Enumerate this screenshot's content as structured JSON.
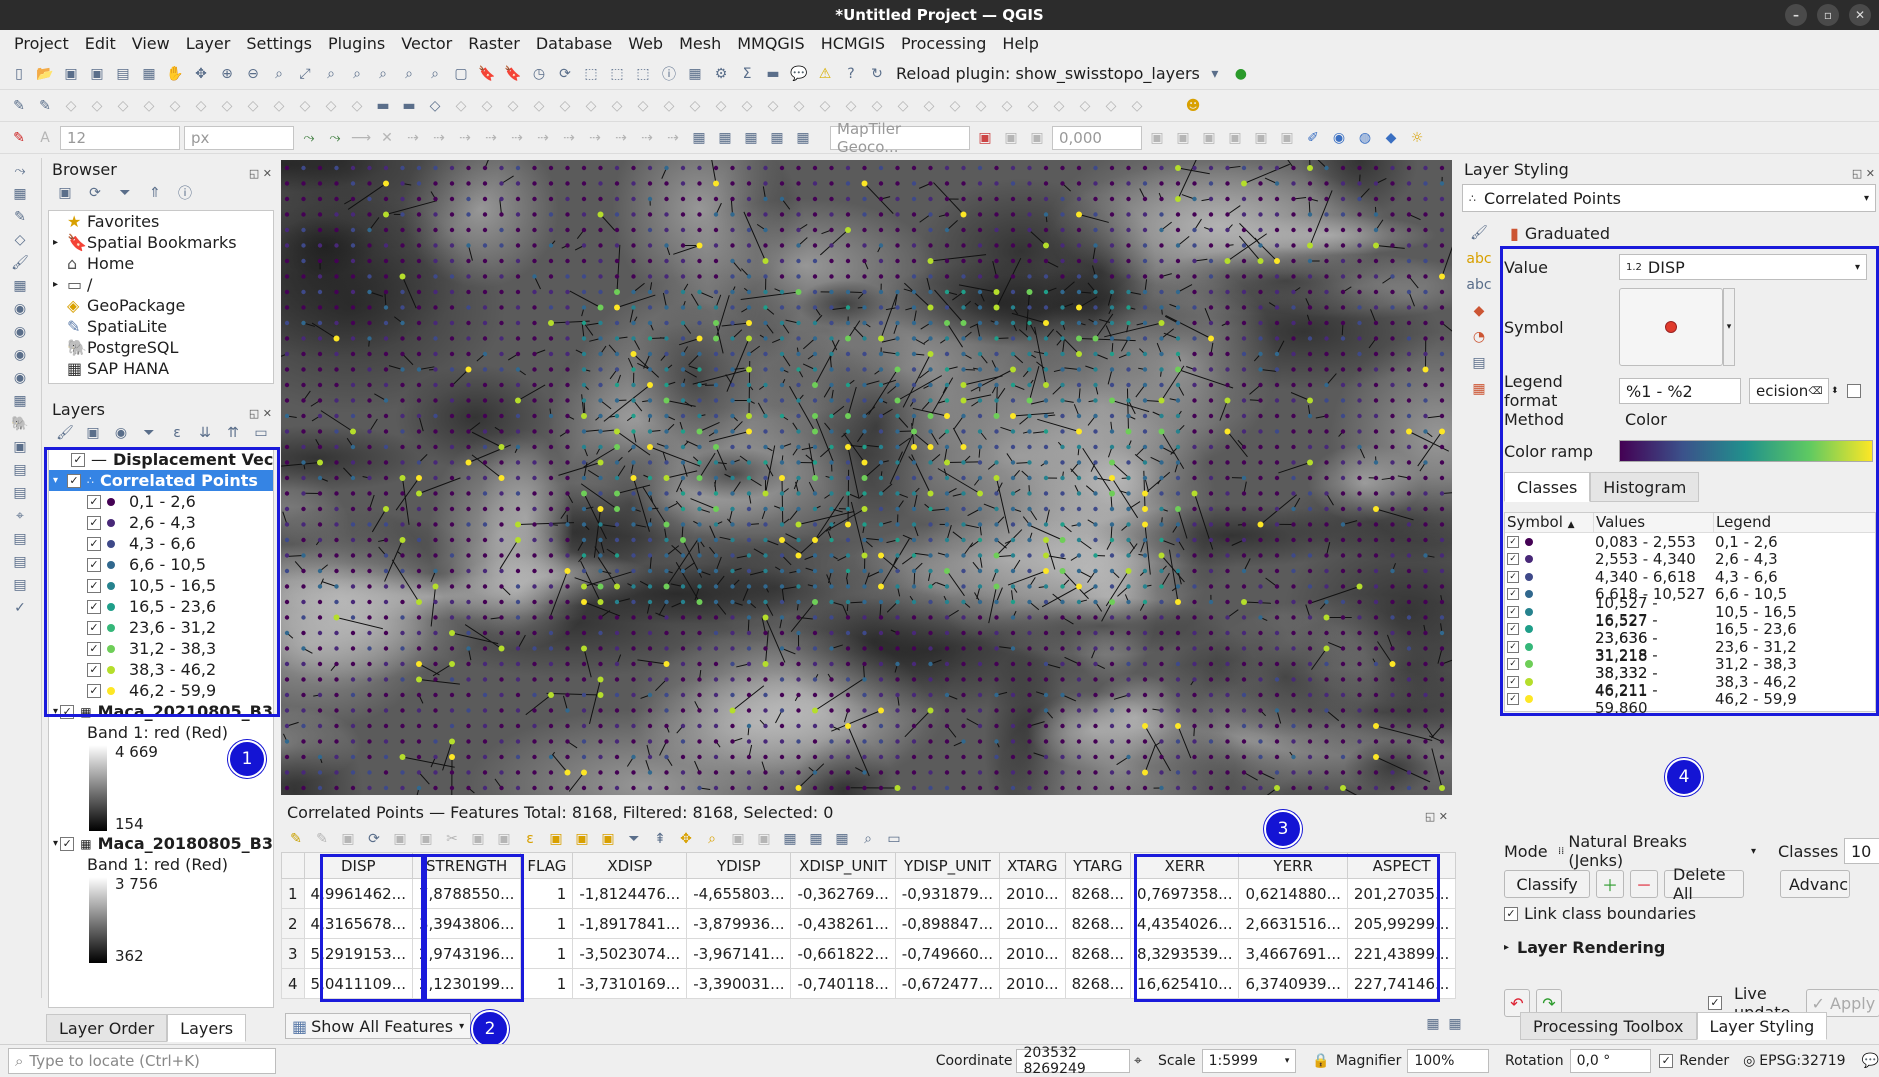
{
  "window": {
    "title": "*Untitled Project — QGIS"
  },
  "menu": [
    "Project",
    "Edit",
    "View",
    "Layer",
    "Settings",
    "Plugins",
    "Vector",
    "Raster",
    "Database",
    "Web",
    "Mesh",
    "MMQGIS",
    "HCMGIS",
    "Processing",
    "Help"
  ],
  "toolbar": {
    "reload_plugin": "Reload plugin: show_swisstopo_layers",
    "font_size": "12",
    "unit": "px",
    "geocoder": "MapTiler Geoco...",
    "value_field": "0,000"
  },
  "browser": {
    "title": "Browser",
    "items": [
      "Favorites",
      "Spatial Bookmarks",
      "Home",
      "/",
      "GeoPackage",
      "SpatiaLite",
      "PostgreSQL",
      "SAP HANA"
    ]
  },
  "layers": {
    "title": "Layers",
    "displacement": "Displacement Vec",
    "correlated": "Correlated Points",
    "classes": [
      "0,1 - 2,6",
      "2,6 - 4,3",
      "4,3 - 6,6",
      "6,6 - 10,5",
      "10,5 - 16,5",
      "16,5 - 23,6",
      "23,6 - 31,2",
      "31,2 - 38,3",
      "38,3 - 46,2",
      "46,2 - 59,9"
    ],
    "class_colors": [
      "#440154",
      "#482878",
      "#3e4989",
      "#31688e",
      "#26828e",
      "#1f9e89",
      "#35b779",
      "#6ece58",
      "#b5de2b",
      "#fde725"
    ],
    "raster1": {
      "name": "Maca_20210805_B3",
      "band": "Band 1: red (Red)",
      "max": "4 669",
      "min": "154"
    },
    "raster2": {
      "name": "Maca_20180805_B3",
      "band": "Band 1: red (Red)",
      "max": "3 756",
      "min": "362"
    }
  },
  "left_tabs": [
    "Layer Order",
    "Layers"
  ],
  "attribute_table": {
    "title": "Correlated Points — Features Total: 8168, Filtered: 8168, Selected: 0",
    "columns": [
      "DISP",
      "STRENGTH",
      "FLAG",
      "XDISP",
      "YDISP",
      "XDISP_UNIT",
      "YDISP_UNIT",
      "XTARG",
      "YTARG",
      "XERR",
      "YERR",
      "ASPECT"
    ],
    "rows": [
      [
        "1",
        "4,9961462...",
        "7,8788550...",
        "1",
        "-1,8124476...",
        "-4,655803...",
        "-0,362769...",
        "-0,931879...",
        "2010...",
        "8268...",
        "0,7697358...",
        "0,6214880...",
        "201,27035..."
      ],
      [
        "2",
        "4,3165678...",
        "3,3943806...",
        "1",
        "-1,8917841...",
        "-3,879936...",
        "-0,438261...",
        "-0,898847...",
        "2010...",
        "8268...",
        "4,4354026...",
        "2,6631516...",
        "205,99299..."
      ],
      [
        "3",
        "5,2919153...",
        "2,9743196...",
        "1",
        "-3,5023074...",
        "-3,967141...",
        "-0,661822...",
        "-0,749660...",
        "2010...",
        "8268...",
        "8,3293539...",
        "3,4667691...",
        "221,43899..."
      ],
      [
        "4",
        "5,0411109...",
        "2,1230199...",
        "1",
        "-3,7310169...",
        "-3,390031...",
        "-0,740118...",
        "-0,672477...",
        "2010...",
        "8268...",
        "16,625410...",
        "6,3740939...",
        "227,74146..."
      ]
    ],
    "show_all": "Show All Features"
  },
  "styling": {
    "title": "Layer Styling",
    "layer": "Correlated Points",
    "renderer": "Graduated",
    "value_label": "Value",
    "value": "DISP",
    "value_type": "1.2",
    "symbol_label": "Symbol",
    "legend_format_label": "Legend format",
    "legend_format": "%1 - %2",
    "precision": "ecision",
    "method_label": "Method",
    "method": "Color",
    "color_ramp_label": "Color ramp",
    "tabs": [
      "Classes",
      "Histogram"
    ],
    "headers": [
      "Symbol",
      "Values",
      "Legend"
    ],
    "values": [
      "0,083 - 2,553",
      "2,553 - 4,340",
      "4,340 - 6,618",
      "6,618 - 10,527",
      "10,527 - 16,527",
      "16,527 - 23,636",
      "23,636 - 31,218",
      "31,218 - 38,332",
      "38,332 - 46,211",
      "46,211 - 59,860"
    ],
    "legends": [
      "0,1 - 2,6",
      "2,6 - 4,3",
      "4,3 - 6,6",
      "6,6 - 10,5",
      "10,5 - 16,5",
      "16,5 - 23,6",
      "23,6 - 31,2",
      "31,2 - 38,3",
      "38,3 - 46,2",
      "46,2 - 59,9"
    ],
    "mode_label": "Mode",
    "mode": "Natural Breaks (Jenks)",
    "classes_label": "Classes",
    "classes": "10",
    "classify": "Classify",
    "delete_all": "Delete All",
    "advanced": "Advanc",
    "link_boundaries": "Link class boundaries",
    "layer_rendering": "Layer Rendering",
    "live_update": "Live update",
    "apply": "Apply"
  },
  "right_tabs": [
    "Processing Toolbox",
    "Layer Styling"
  ],
  "status": {
    "locate_placeholder": "Type to locate (Ctrl+K)",
    "coordinate_label": "Coordinate",
    "coordinate": "203532  8269249",
    "scale_label": "Scale",
    "scale": "1:5999",
    "magnifier_label": "Magnifier",
    "magnifier": "100%",
    "rotation_label": "Rotation",
    "rotation": "0,0 °",
    "render": "Render",
    "crs": "EPSG:32719"
  },
  "badges": [
    "1",
    "2",
    "3",
    "4"
  ]
}
